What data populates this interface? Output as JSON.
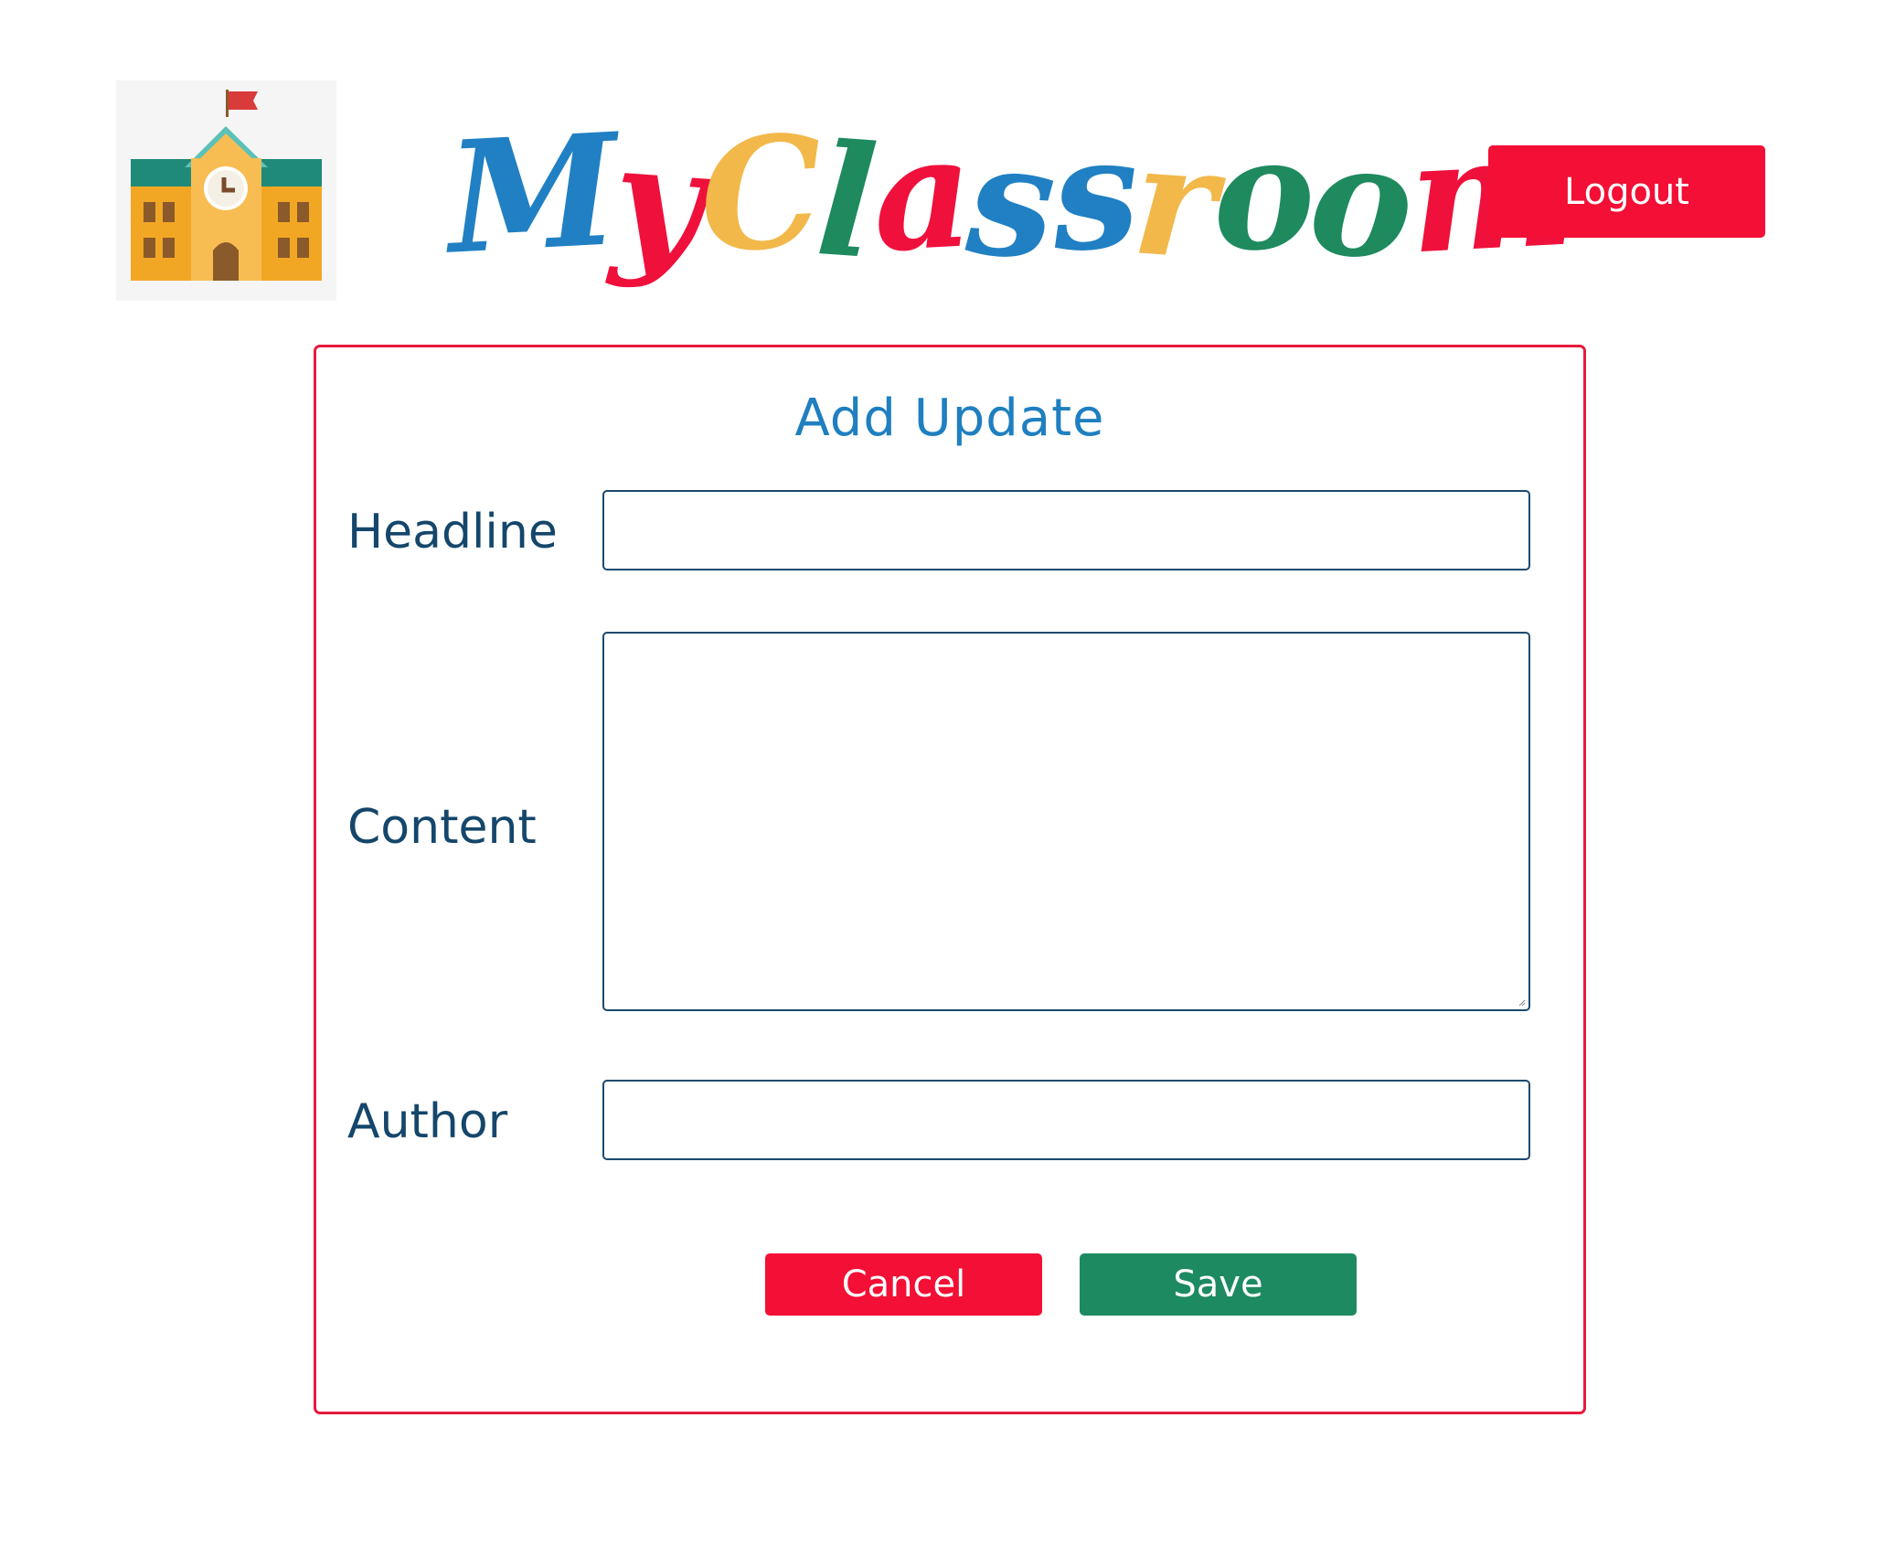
{
  "header": {
    "logo_icon": "school-building-icon",
    "brand_title": "MyClassroom",
    "brand_letter_colors": [
      "#2080c3",
      "#f0103c",
      "#f2b84a",
      "#1e8a5e",
      "#f0103c",
      "#2080c3",
      "#2080c3",
      "#f2b84a",
      "#1e8a5e",
      "#1e8a5e",
      "#f0103c"
    ],
    "logout_label": "Logout"
  },
  "form": {
    "title": "Add Update",
    "fields": {
      "headline": {
        "label": "Headline",
        "value": ""
      },
      "content": {
        "label": "Content",
        "value": ""
      },
      "author": {
        "label": "Author",
        "value": ""
      }
    },
    "cancel_label": "Cancel",
    "save_label": "Save"
  },
  "colors": {
    "accent_red": "#f30f35",
    "save_green": "#1e8a62",
    "title_blue": "#1f7fc0",
    "label_navy": "#15466b",
    "card_border": "#e8193c"
  }
}
